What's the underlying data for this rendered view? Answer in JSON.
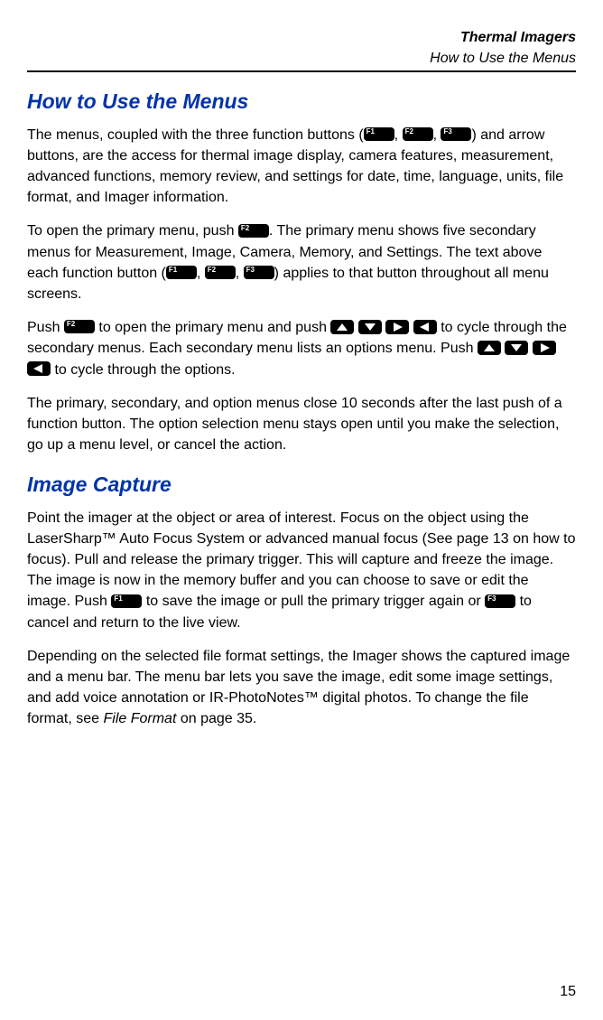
{
  "header": {
    "title": "Thermal Imagers",
    "subtitle": "How to Use the Menus"
  },
  "buttons": {
    "f1": "F1",
    "f2": "F2",
    "f3": "F3"
  },
  "section1": {
    "heading": "How to Use the Menus",
    "p1a": "The menus, coupled with the three function buttons (",
    "p1b": ", ",
    "p1c": ", ",
    "p1d": ") and arrow buttons, are the access for thermal image display, camera features, measurement, advanced functions, memory review, and settings for date, time, language, units, file format, and Imager information.",
    "p2a": "To open the primary menu, push ",
    "p2b": ". The primary menu shows five secondary menus for Measurement, Image, Camera, Memory, and Settings. The text above each function button (",
    "p2c": ", ",
    "p2d": ", ",
    "p2e": ") applies to that button throughout all menu screens.",
    "p3a": "Push ",
    "p3b": " to open the primary menu and push ",
    "p3c": " to cycle through the secondary menus. Each secondary menu lists an options menu. Push ",
    "p3d": " to cycle through the options.",
    "p4": "The primary, secondary, and option menus close 10 seconds after the last push of a function button. The option selection menu stays open until you make the selection, go up a menu level, or cancel the action."
  },
  "section2": {
    "heading": "Image Capture",
    "p1a": "Point the imager at the object or area of interest. Focus on the object using the LaserSharp™ Auto Focus System or advanced manual focus (See page 13 on how to focus). Pull and release the primary trigger. This will capture and freeze the image. The image is now in the memory buffer and you can choose to save or edit the image. Push ",
    "p1b": " to save the image or pull the primary trigger again or ",
    "p1c": " to cancel and return to the live view.",
    "p2a": "Depending on the selected file format settings, the Imager shows the captured image and a menu bar. The menu bar lets you save the image, edit some image settings, and add voice annotation or IR-PhotoNotes™ digital photos. To change the file format, see ",
    "p2b": "File Format",
    "p2c": " on page 35."
  },
  "page_number": "15"
}
